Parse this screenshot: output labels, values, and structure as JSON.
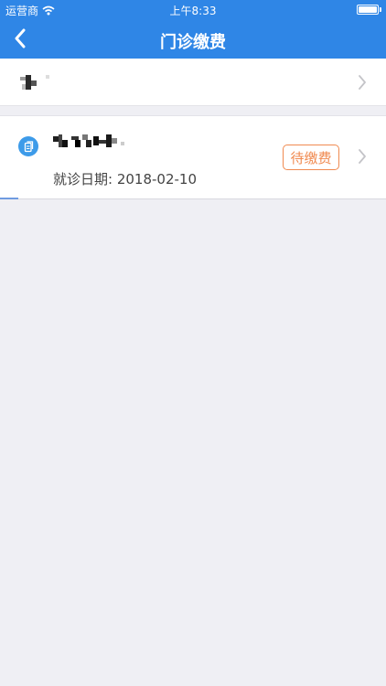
{
  "status_bar": {
    "carrier": "运营商",
    "time": "上午8:33"
  },
  "nav": {
    "title": "门诊缴费",
    "back_icon": "chevron-left-icon"
  },
  "top_row": {
    "chevron_icon": "chevron-right-icon"
  },
  "record": {
    "icon": "document-icon",
    "date_label": "就诊日期: 2018-02-10",
    "status": "待缴费",
    "chevron_icon": "chevron-right-icon"
  },
  "colors": {
    "header": "#2f86e6",
    "status_badge": "#f08a50",
    "background": "#efeff4"
  }
}
